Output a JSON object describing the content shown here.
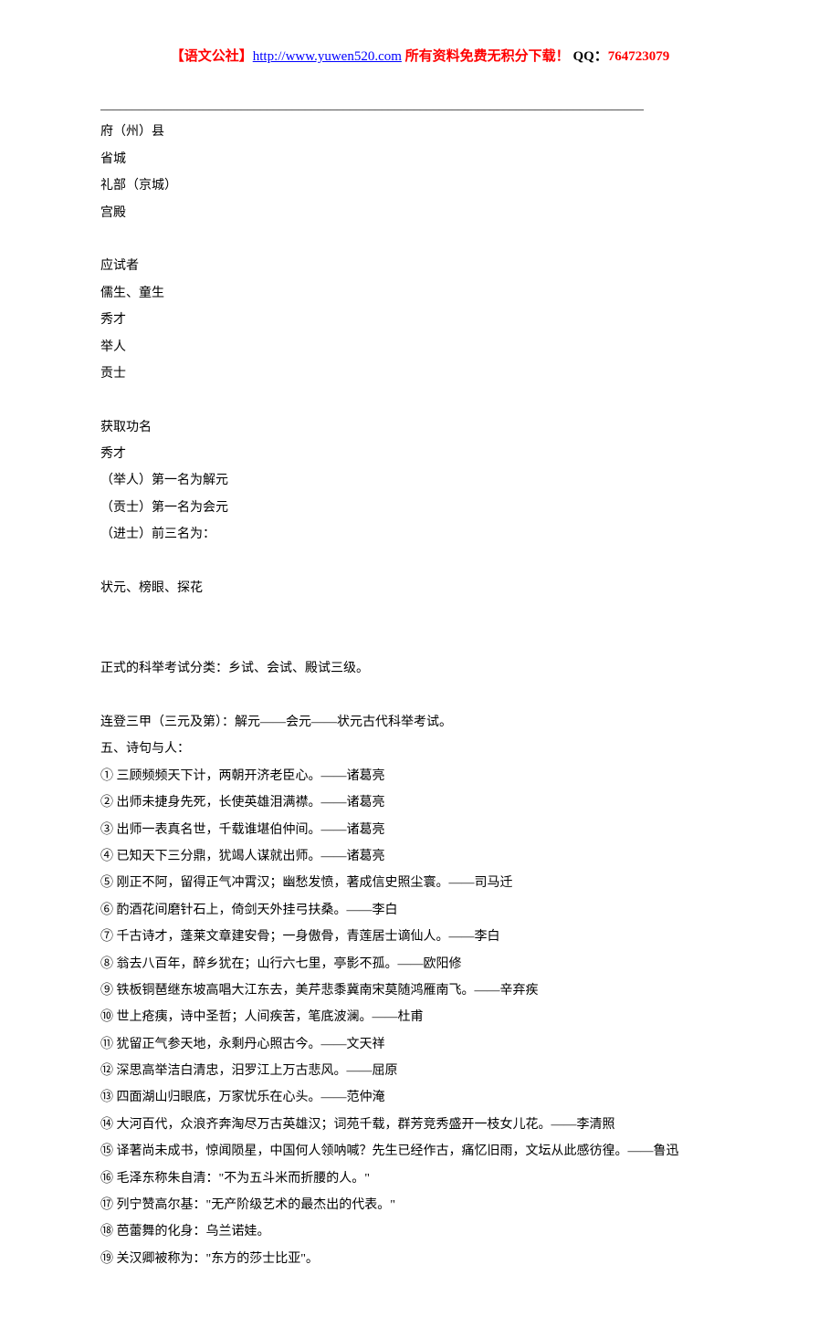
{
  "header": {
    "brand": "【语文公社】",
    "url": "http://www.yuwen520.com",
    "suffix": " 所有资料免费无积分下载！",
    "qq_label": "QQ：",
    "qq_num": "764723079"
  },
  "blank_line": "_____________________________________________________________________________________",
  "body_lines": [
    "府（州）县",
    "省城",
    "礼部（京城）",
    "宫殿",
    "",
    "应试者",
    "儒生、童生",
    "秀才",
    "举人",
    "贡士",
    "",
    "获取功名",
    "秀才",
    "（举人）第一名为解元",
    "（贡士）第一名为会元",
    "（进士）前三名为：",
    "",
    "状元、榜眼、探花",
    "",
    "",
    "正式的科举考试分类：乡试、会试、殿试三级。",
    "",
    "连登三甲（三元及第）：解元——会元——状元古代科举考试。",
    "五、诗句与人：",
    "① 三顾频频天下计，两朝开济老臣心。——诸葛亮",
    "② 出师未捷身先死，长使英雄泪满襟。——诸葛亮",
    "③ 出师一表真名世，千载谁堪伯仲间。——诸葛亮",
    "④ 已知天下三分鼎，犹竭人谋就出师。——诸葛亮",
    "⑤ 刚正不阿，留得正气冲霄汉；幽愁发愤，著成信史照尘寰。——司马迁",
    "⑥ 酌酒花间磨针石上，倚剑天外挂弓扶桑。——李白",
    "⑦ 千古诗才，蓬莱文章建安骨；一身傲骨，青莲居士谪仙人。——李白",
    "⑧ 翁去八百年，醉乡犹在；山行六七里，亭影不孤。——欧阳修",
    "⑨ 铁板铜琶继东坡高唱大江东去，美芹悲黍冀南宋莫随鸿雁南飞。——辛弃疾",
    "⑩ 世上疮痍，诗中圣哲；人间疾苦，笔底波澜。——杜甫",
    "⑪ 犹留正气参天地，永剩丹心照古今。——文天祥",
    "⑫ 深思高举洁白清忠，汨罗江上万古悲风。——屈原",
    "⑬ 四面湖山归眼底，万家忧乐在心头。——范仲淹",
    "⑭ 大河百代，众浪齐奔淘尽万古英雄汉；词苑千载，群芳竞秀盛开一枝女儿花。——李清照",
    "⑮ 译著尚未成书，惊闻陨星，中国何人领呐喊？先生已经作古，痛忆旧雨，文坛从此感彷徨。——鲁迅",
    "⑯ 毛泽东称朱自清：\"不为五斗米而折腰的人。\"",
    "⑰ 列宁赞高尔基：\"无产阶级艺术的最杰出的代表。\"",
    "⑱ 芭蕾舞的化身：乌兰诺娃。",
    "⑲ 关汉卿被称为：\"东方的莎士比亚\"。"
  ]
}
